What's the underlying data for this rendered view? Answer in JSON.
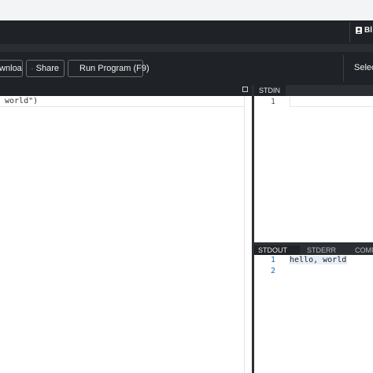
{
  "header": {
    "user_label": "Bl"
  },
  "toolbar": {
    "download_label": "Download",
    "share_label": "Share",
    "run_label": "Run Program (F9)",
    "select_label": "Select"
  },
  "editor": {
    "code_line": "world\")"
  },
  "stdin": {
    "tab_label": "STDIN",
    "line_numbers": [
      "1"
    ]
  },
  "output": {
    "tabs": [
      {
        "label": "STDOUT",
        "active": true
      },
      {
        "label": "STDERR",
        "active": false
      },
      {
        "label": "COMPILE OUTPUT",
        "active": false
      }
    ],
    "line_numbers": [
      "1",
      "2"
    ],
    "stdout_lines": [
      "hello, world",
      ""
    ]
  },
  "colors": {
    "header_bg": "#1f2226",
    "divider": "#2b2e33",
    "run_icon": "#f5a623",
    "line_number": "#1a6aa8"
  },
  "icons": {
    "share": "share-arrow-icon",
    "run": "play-triangle-icon",
    "user": "user-icon",
    "maximize": "maximize-icon"
  }
}
